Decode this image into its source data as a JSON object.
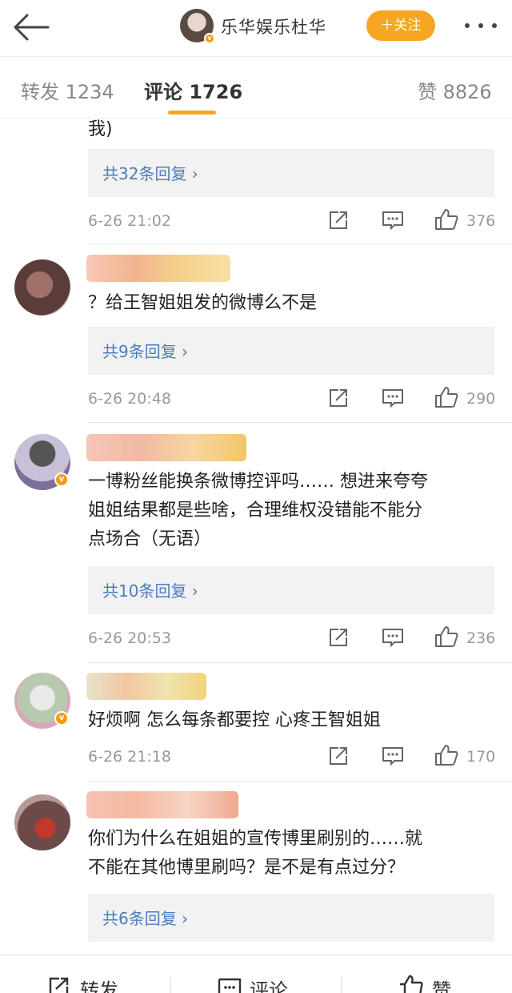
{
  "header": {
    "title": "乐华娱乐杜华",
    "follow_label": "＋关注",
    "badge": "v"
  },
  "tabs": [
    {
      "label": "转发 1234"
    },
    {
      "label": "评论 1726"
    },
    {
      "label": "赞 8826"
    }
  ],
  "comments": [
    {
      "text_lines": [
        "我)"
      ],
      "reply_label": "共32条回复 ›",
      "time": "6-26 21:02",
      "likes": "376"
    },
    {
      "text_lines": [
        "？给王智姐姐发的微博么不是"
      ],
      "reply_label": "共9条回复 ›",
      "time": "6-26 20:48",
      "likes": "290"
    },
    {
      "text_lines": [
        "一博粉丝能换条微博控评吗…… 想进来夸夸",
        "姐姐结果都是些啥，合理维权没错能不能分",
        "点场合（无语）"
      ],
      "reply_label": "共10条回复 ›",
      "time": "6-26 20:53",
      "likes": "236"
    },
    {
      "text_lines": [
        "好烦啊 怎么每条都要控 心疼王智姐姐"
      ],
      "time": "6-26 21:18",
      "likes": "170"
    },
    {
      "text_lines": [
        "你们为什么在姐姐的宣传博里刷别的……就",
        "不能在其他博里刷吗？是不是有点过分？"
      ],
      "reply_label": "共6条回复 ›"
    }
  ],
  "bottom_bar": {
    "repost_label": "转发",
    "comment_label": "评论",
    "like_label": "赞"
  },
  "colors": {
    "accent": "#f5a623",
    "reply_link": "#4a7cbf",
    "meta": "#999999"
  },
  "icons": [
    "back-arrow-icon",
    "more-dots-icon",
    "verified-icon",
    "repost-icon",
    "comment-icon",
    "like-icon"
  ]
}
